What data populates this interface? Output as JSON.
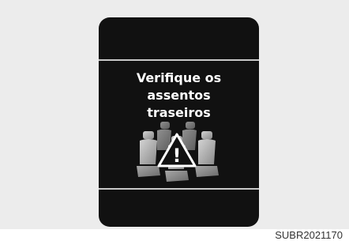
{
  "screen": {
    "message_lines": [
      "Verifique os",
      "assentos",
      "traseiros"
    ],
    "icon": "rear-seats-warning-icon",
    "warning_symbol": "!"
  },
  "figure_code": "SUBR2021170",
  "colors": {
    "screen_background": "#111111",
    "panel_background": "#ececec",
    "text": "#ffffff",
    "seat_fill": "#b5b5b5",
    "divider": "#c8c8c8"
  }
}
